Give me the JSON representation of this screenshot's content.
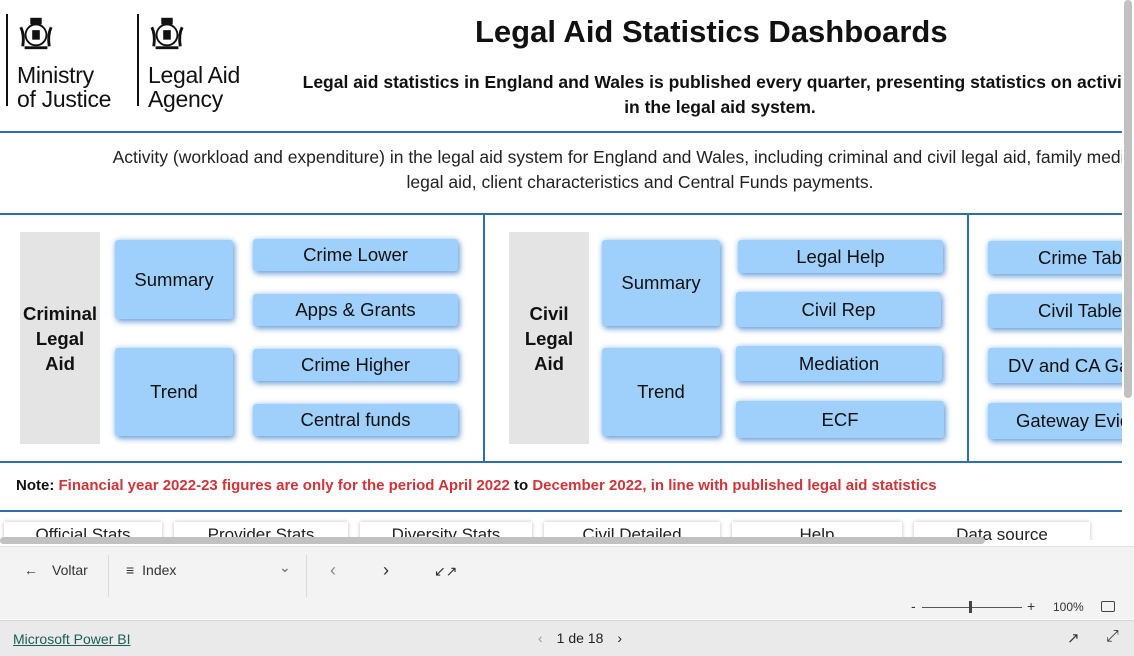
{
  "header": {
    "logo_moj_line1": "Ministry",
    "logo_moj_line2": "of Justice",
    "logo_laa_line1": "Legal Aid",
    "logo_laa_line2": "Agency",
    "title": "Legal Aid Statistics Dashboards",
    "subtitle_line1": "Legal aid statistics in England and Wales is published every quarter, presenting statistics on activity",
    "subtitle_line2": "in the legal aid system."
  },
  "description": {
    "line1": "Activity (workload and expenditure) in the legal aid system for England and Wales, including criminal and civil legal aid, family mediation,",
    "line2": "legal aid, client characteristics and Central Funds payments."
  },
  "criminal": {
    "label_l1": "Criminal",
    "label_l2": "Legal",
    "label_l3": "Aid",
    "summary": "Summary",
    "trend": "Trend",
    "crime_lower": "Crime Lower",
    "apps_grants": "Apps & Grants",
    "crime_higher": "Crime Higher",
    "central_funds": "Central funds"
  },
  "civil": {
    "label_l1": "Civil",
    "label_l2": "Legal",
    "label_l3": "Aid",
    "summary": "Summary",
    "trend": "Trend",
    "legal_help": "Legal Help",
    "civil_rep": "Civil Rep",
    "mediation": "Mediation",
    "ecf": "ECF"
  },
  "tables": {
    "crime_tables": "Crime Tables",
    "civil_tables": "Civil Tables",
    "dv_ca": "DV and CA Gateway",
    "gateway": "Gateway Evidence"
  },
  "note": {
    "label": "Note:",
    "text_a": "Financial year 2022-23 figures are only for the period April 2022",
    "to": "to",
    "text_b": "December 2022, in line with published legal aid statistics"
  },
  "tabs": [
    "Official Stats",
    "Provider Stats",
    "Diversity Stats",
    "Civil Detailed",
    "Help",
    "Data source"
  ],
  "navbar": {
    "back": "Voltar",
    "index": "Index",
    "zoom": "100%"
  },
  "footer": {
    "brand": "Microsoft Power BI",
    "page": "1 de 18"
  }
}
